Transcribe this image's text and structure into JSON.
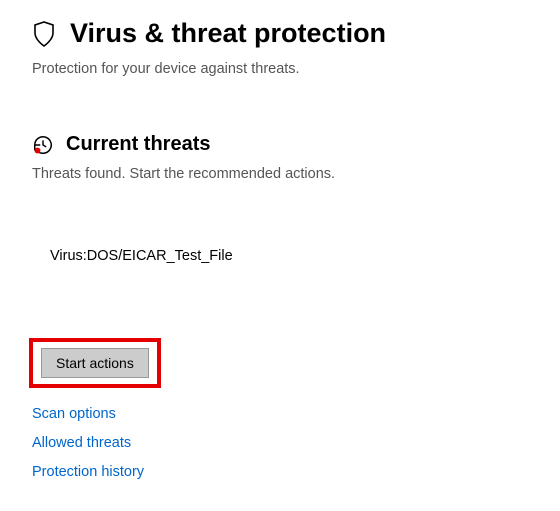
{
  "header": {
    "title": "Virus & threat protection",
    "subtitle": "Protection for your device against threats."
  },
  "section": {
    "title": "Current threats",
    "subtitle": "Threats found. Start the recommended actions."
  },
  "threats": [
    {
      "name": "Virus:DOS/EICAR_Test_File"
    }
  ],
  "actions": {
    "start_button": "Start actions"
  },
  "links": {
    "scan_options": "Scan options",
    "allowed_threats": "Allowed threats",
    "protection_history": "Protection history"
  }
}
